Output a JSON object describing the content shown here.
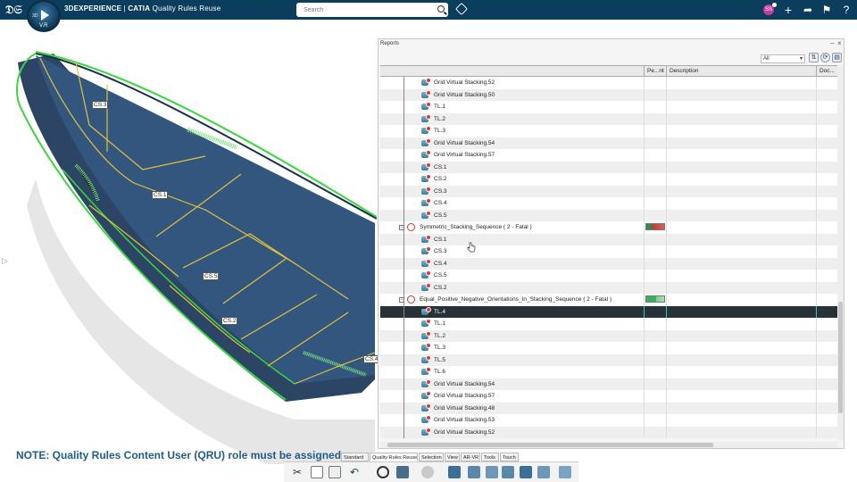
{
  "app": {
    "brand_prefix": "3DEXPERIENCE",
    "brand_app": "CATIA",
    "brand_context": "Quality Rules Reuse",
    "compass_version": "V.R",
    "compass_3d": "3D"
  },
  "search": {
    "placeholder": "Search"
  },
  "user": {
    "initials": "SS"
  },
  "viewport": {
    "labels": [
      "CS.3",
      "CS.1",
      "CS.5",
      "CS.2",
      "CS.4"
    ],
    "note": "NOTE: Quality Rules Content User (QRU) role must be assigned"
  },
  "reports": {
    "title": "Reports",
    "filter_value": "All",
    "columns": [
      "",
      "Pe...nt",
      "Description",
      "Doc..."
    ],
    "rows": [
      {
        "label": "Grid Virtual Stacking.52",
        "indent": 2,
        "type": "item"
      },
      {
        "label": "Grid Virtual Stacking.50",
        "indent": 2,
        "type": "item"
      },
      {
        "label": "TL.1",
        "indent": 2,
        "type": "item"
      },
      {
        "label": "TL.2",
        "indent": 2,
        "type": "item"
      },
      {
        "label": "TL.3",
        "indent": 2,
        "type": "item"
      },
      {
        "label": "Grid Virtual Stacking.54",
        "indent": 2,
        "type": "item"
      },
      {
        "label": "Grid Virtual Stacking.57",
        "indent": 2,
        "type": "item"
      },
      {
        "label": "CS.1",
        "indent": 2,
        "type": "item"
      },
      {
        "label": "CS.2",
        "indent": 2,
        "type": "item"
      },
      {
        "label": "CS.3",
        "indent": 2,
        "type": "item"
      },
      {
        "label": "CS.4",
        "indent": 2,
        "type": "item"
      },
      {
        "label": "CS.5",
        "indent": 2,
        "type": "item"
      },
      {
        "label": "Symmetric_Stacking_Sequence ( 2 - Fatal )",
        "indent": 1,
        "type": "rule",
        "pen": "red"
      },
      {
        "label": "CS.1",
        "indent": 2,
        "type": "item"
      },
      {
        "label": "CS.3",
        "indent": 2,
        "type": "item"
      },
      {
        "label": "CS.4",
        "indent": 2,
        "type": "item"
      },
      {
        "label": "CS.5",
        "indent": 2,
        "type": "item"
      },
      {
        "label": "CS.2",
        "indent": 2,
        "type": "item"
      },
      {
        "label": "Equal_Positive_Negative_Orientations_In_Stacking_Sequence ( 2 - Fatal )",
        "indent": 1,
        "type": "rule",
        "pen": "green"
      },
      {
        "label": "TL.4",
        "indent": 2,
        "type": "item",
        "selected": true
      },
      {
        "label": "TL.1",
        "indent": 2,
        "type": "item"
      },
      {
        "label": "TL.2",
        "indent": 2,
        "type": "item"
      },
      {
        "label": "TL.3",
        "indent": 2,
        "type": "item"
      },
      {
        "label": "TL.5",
        "indent": 2,
        "type": "item"
      },
      {
        "label": "TL.6",
        "indent": 2,
        "type": "item"
      },
      {
        "label": "Grid Virtual Stacking.54",
        "indent": 2,
        "type": "item"
      },
      {
        "label": "Grid Virtual Stacking.57",
        "indent": 2,
        "type": "item"
      },
      {
        "label": "Grid Virtual Stacking.48",
        "indent": 2,
        "type": "item"
      },
      {
        "label": "Grid Virtual Stacking.53",
        "indent": 2,
        "type": "item"
      },
      {
        "label": "Grid Virtual Stacking.52",
        "indent": 2,
        "type": "item"
      }
    ]
  },
  "action_tabs": [
    "Standard",
    "Quality Rules Reuse",
    "Selection",
    "View",
    "AR-VR",
    "Tools",
    "Touch"
  ],
  "active_tab": "Quality Rules Reuse",
  "colors": {
    "topbar": "#0b3d5c",
    "hull": "#2c4a6e",
    "edge_green": "#39d63f",
    "ply_yellow": "#e3c23a",
    "selected_row": "#263238",
    "note_text": "#1f5d86"
  }
}
